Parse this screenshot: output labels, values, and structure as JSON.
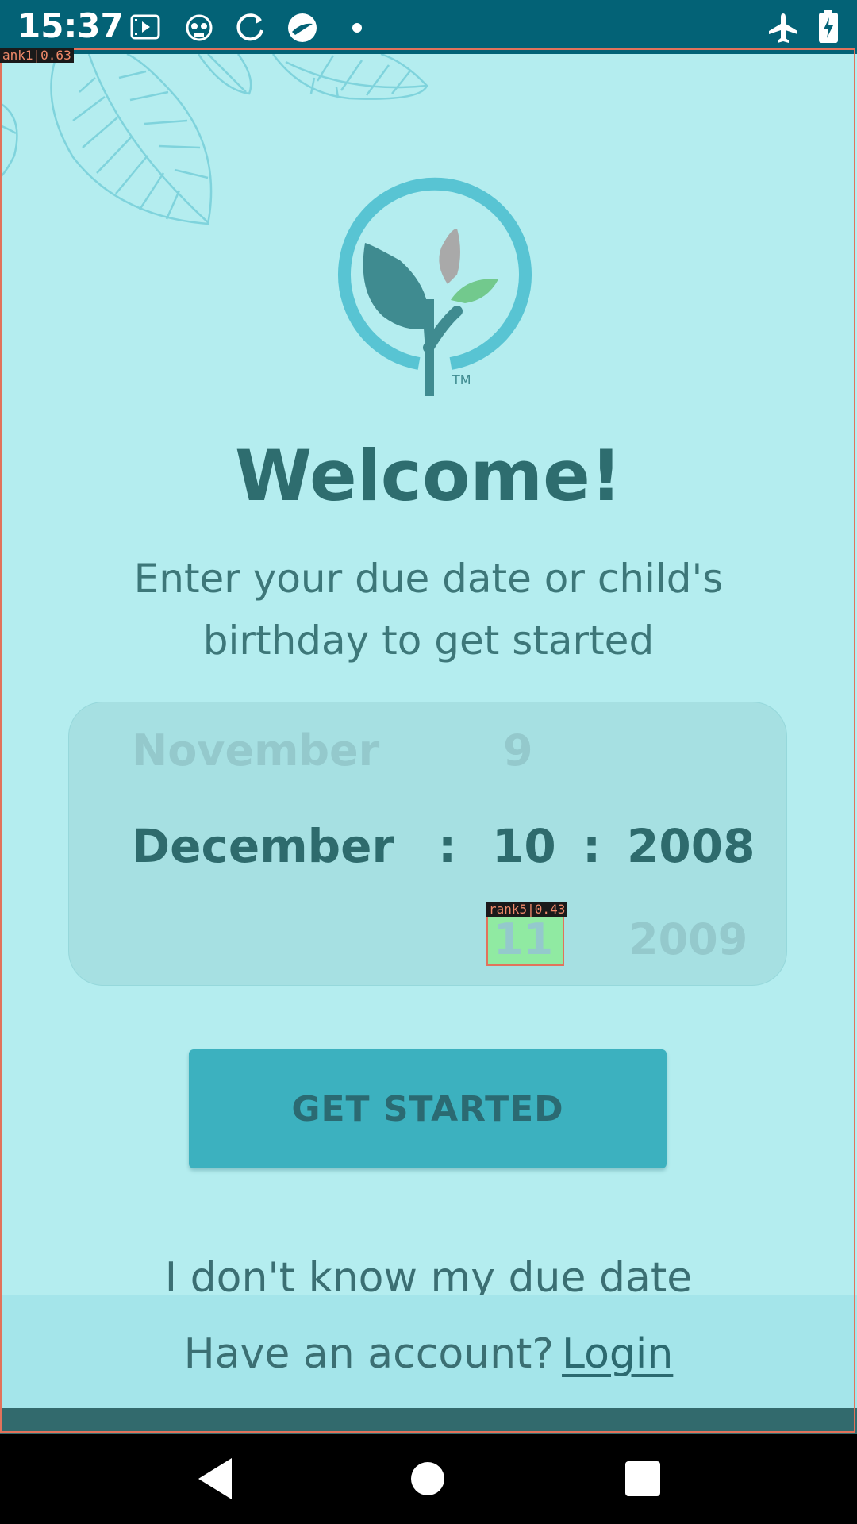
{
  "status_bar": {
    "time": "15:37",
    "icons": [
      "screen-record-icon",
      "monkey-icon",
      "sync-icon",
      "app-icon",
      "dot-icon",
      "airplane-mode-icon",
      "battery-charging-icon"
    ]
  },
  "overlays": {
    "top_tag": "ank1|0.63",
    "picker_tag": "rank5|0.43"
  },
  "welcome": {
    "title": "Welcome!",
    "subtitle_line1": "Enter your due date or child's",
    "subtitle_line2": "birthday to get started"
  },
  "date_picker": {
    "month_prev": "November",
    "month_selected": "December",
    "day_prev": "9",
    "day_selected": "10",
    "day_next": "11",
    "year_selected": "2008",
    "year_next": "2009",
    "separator": ":"
  },
  "actions": {
    "get_started": "GET STARTED",
    "dont_know": "I don't know my due date"
  },
  "footer": {
    "have_account": "Have an account?",
    "login": "Login"
  },
  "colors": {
    "background": "#b4edef",
    "status_bar": "#036276",
    "accent": "#3cb1bf",
    "text_dark": "#2e6d6f"
  }
}
